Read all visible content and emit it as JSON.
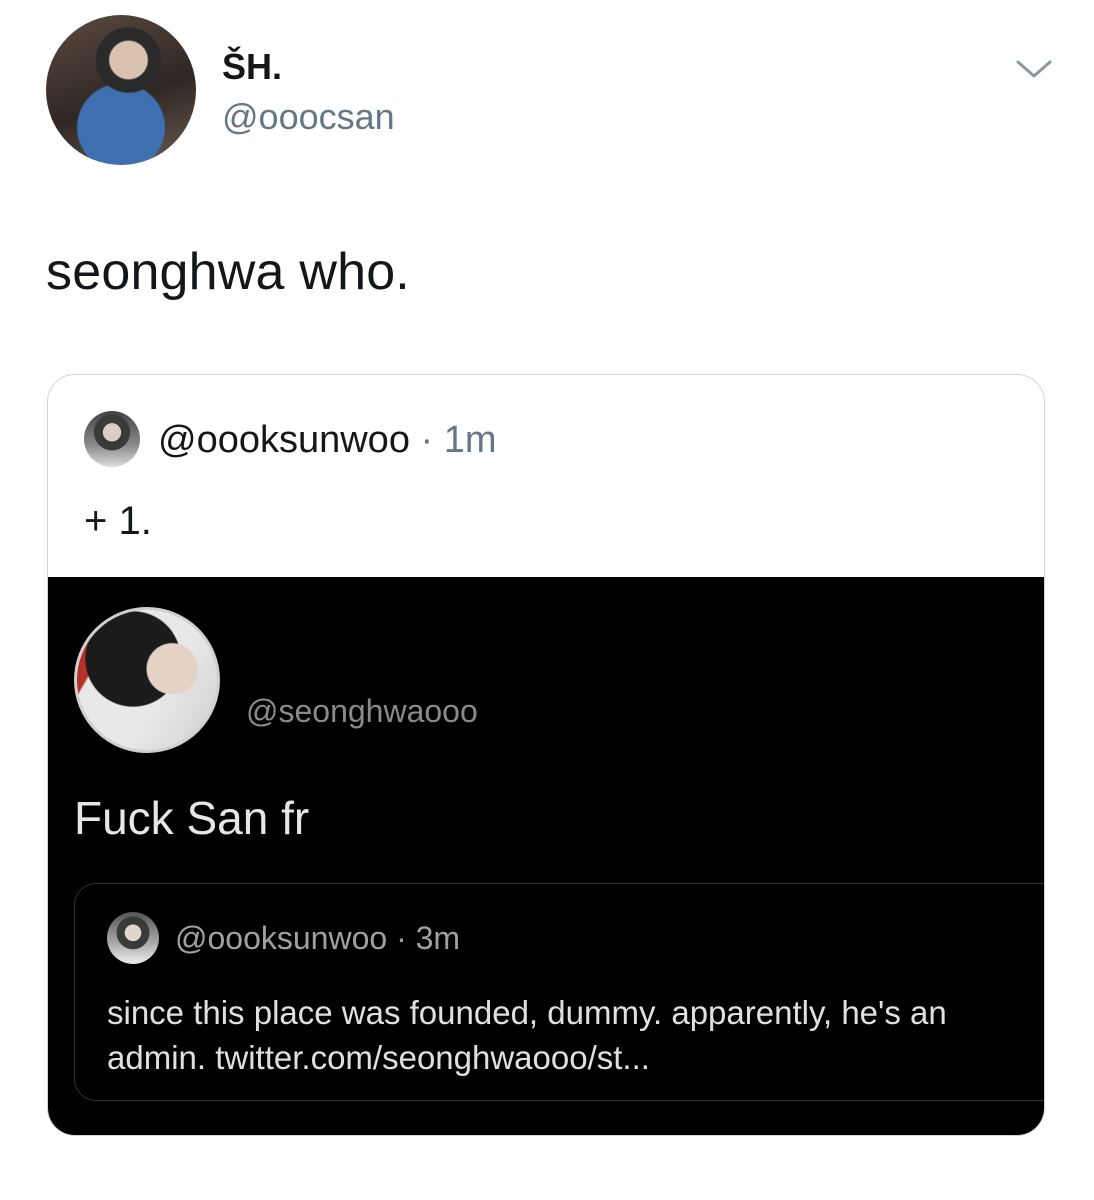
{
  "tweet": {
    "display_name": "ŠH.",
    "handle": "@ooocsan",
    "text": "seonghwa who."
  },
  "quoted_tweet": {
    "handle": "@oooksunwoo",
    "separator": "·",
    "time": "1m",
    "text": "+ 1.",
    "screenshot": {
      "handle": "@seonghwaooo",
      "text": "Fuck San fr",
      "nested_quote": {
        "handle": "@oooksunwoo",
        "separator": "·",
        "time": "3m",
        "text_line1": "since this place was founded, dummy. apparently, he's an",
        "text_line2": "admin. twitter.com/seonghwaooo/st..."
      }
    }
  },
  "icons": {
    "menu": "chevron-down-icon"
  },
  "colors": {
    "secondary_text": "#657786",
    "card_border": "#ccd6dd",
    "dark_background": "#000000"
  }
}
